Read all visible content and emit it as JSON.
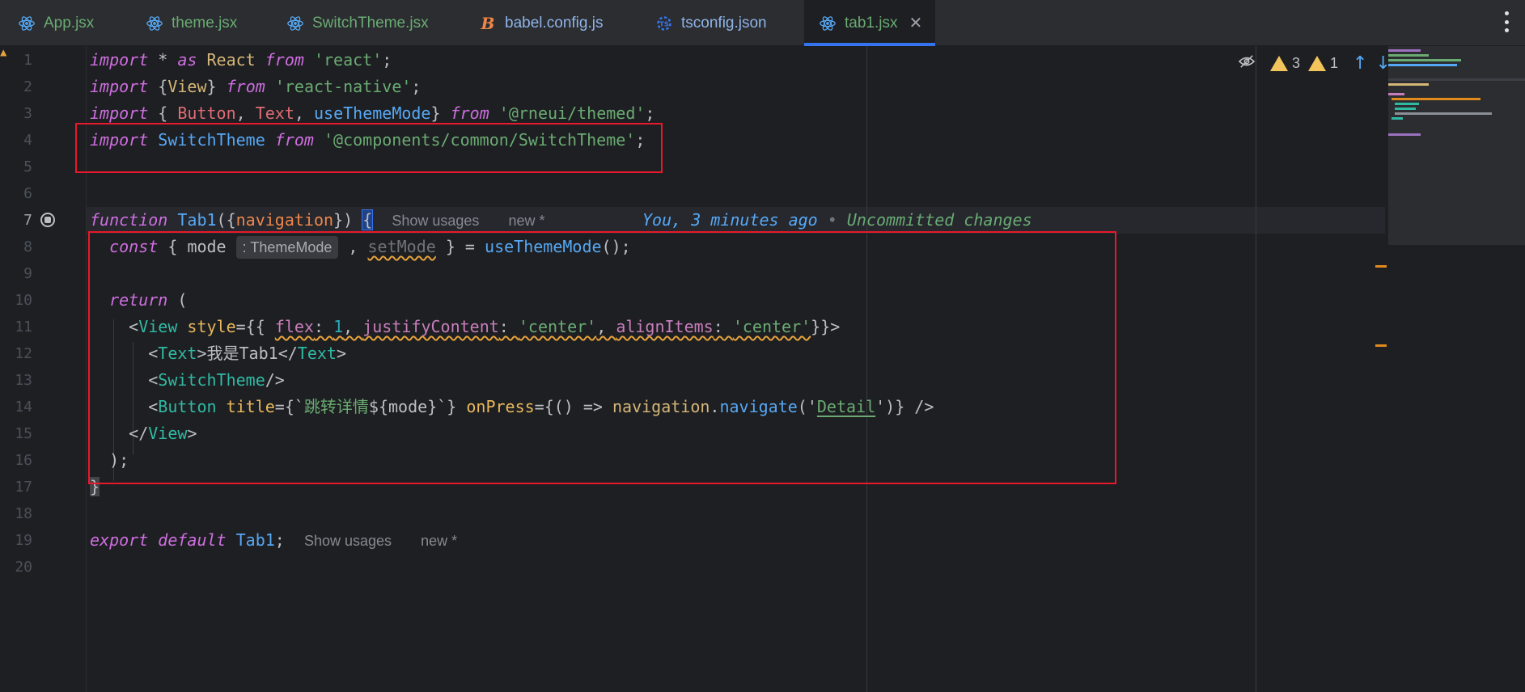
{
  "tabs": [
    {
      "label": "App.jsx",
      "icon": "react-icon"
    },
    {
      "label": "theme.jsx",
      "icon": "react-icon"
    },
    {
      "label": "SwitchTheme.jsx",
      "icon": "react-icon"
    },
    {
      "label": "babel.config.js",
      "icon": "babel-icon"
    },
    {
      "label": "tsconfig.json",
      "icon": "typescript-config-icon"
    },
    {
      "label": "tab1.jsx",
      "icon": "react-icon",
      "active": true
    }
  ],
  "line_numbers": [
    "1",
    "2",
    "3",
    "4",
    "5",
    "6",
    "7",
    "8",
    "9",
    "10",
    "11",
    "12",
    "13",
    "14",
    "15",
    "16",
    "17",
    "18",
    "19",
    "20"
  ],
  "code": {
    "l1": {
      "import": "import",
      "star": " * ",
      "as": "as",
      "react": " React ",
      "from": "from",
      "str": " 'react'",
      "semi": ";"
    },
    "l2": {
      "import": "import",
      "open": " {",
      "view": "View",
      "close": "} ",
      "from": "from",
      "str": " 'react-native'",
      "semi": ";"
    },
    "l3": {
      "import": "import",
      "open": " { ",
      "button": "Button",
      "c1": ", ",
      "text": "Text",
      "c2": ", ",
      "hook": "useThemeMode",
      "close": "} ",
      "from": "from",
      "str": " '@rneui/themed'",
      "semi": ";"
    },
    "l4": {
      "import": "import",
      "name": " SwitchTheme ",
      "from": "from",
      "str": " '@components/common/SwitchTheme'",
      "semi": ";"
    },
    "l7": {
      "fn": "function",
      "name": " Tab1",
      "open": "({",
      "param": "navigation",
      "close": "}) ",
      "brace": "{",
      "hint_usages": "Show usages",
      "hint_new": "new *",
      "blame_you": "You",
      "blame_time": ", 3 minutes ago",
      "blame_dot": " • ",
      "blame_status": "Uncommitted changes"
    },
    "l8": {
      "const": "const",
      "open": " { ",
      "mode": "mode",
      "type_hint": ": ThemeMode",
      "comma": " , ",
      "setmode": "setMode",
      "close": " } = ",
      "call": "useThemeMode",
      "end": "();"
    },
    "l10": {
      "ret": "return",
      "paren": " ("
    },
    "l11": {
      "lt": "<",
      "tag": "View",
      "attr": " style",
      "eq": "={{ ",
      "p1": "flex",
      "c1": ": ",
      "v1": "1",
      "s1": ", ",
      "p2": "justifyContent",
      "c2": ": ",
      "v2": "'center'",
      "s2": ", ",
      "p3": "alignItems",
      "c3": ": ",
      "v3": "'center'",
      "end": "}}>"
    },
    "l12": {
      "lt": "<",
      "tag": "Text",
      "gt": ">",
      "content": "我是Tab1",
      "lt2": "</",
      "tag2": "Text",
      "gt2": ">"
    },
    "l13": {
      "lt": "<",
      "tag": "SwitchTheme",
      "end": "/>"
    },
    "l14": {
      "lt": "<",
      "tag": "Button",
      "attr1": " title",
      "eq1": "={`",
      "tpl": "跳转详情",
      "interp_open": "${",
      "interp": "mode",
      "interp_close": "}",
      "tick": "`} ",
      "attr2": "onPress",
      "eq2": "={() => ",
      "nav": "navigation",
      "dot": ".",
      "method": "navigate",
      "popen": "('",
      "arg": "Detail",
      "pclose": "')} />"
    },
    "l15": {
      "lt": "</",
      "tag": "View",
      "gt": ">"
    },
    "l16": {
      "text": ");"
    },
    "l17": {
      "text": "}"
    },
    "l19": {
      "export": "export",
      "default": " default",
      "name": " Tab1",
      "semi": ";",
      "hint_usages": "Show usages",
      "hint_new": "new *"
    }
  },
  "inspections": {
    "warnings_a": "3",
    "warnings_b": "1"
  },
  "colors": {
    "accent": "#3574f0",
    "annotation": "#e8192c",
    "warning": "#f2c55c"
  }
}
